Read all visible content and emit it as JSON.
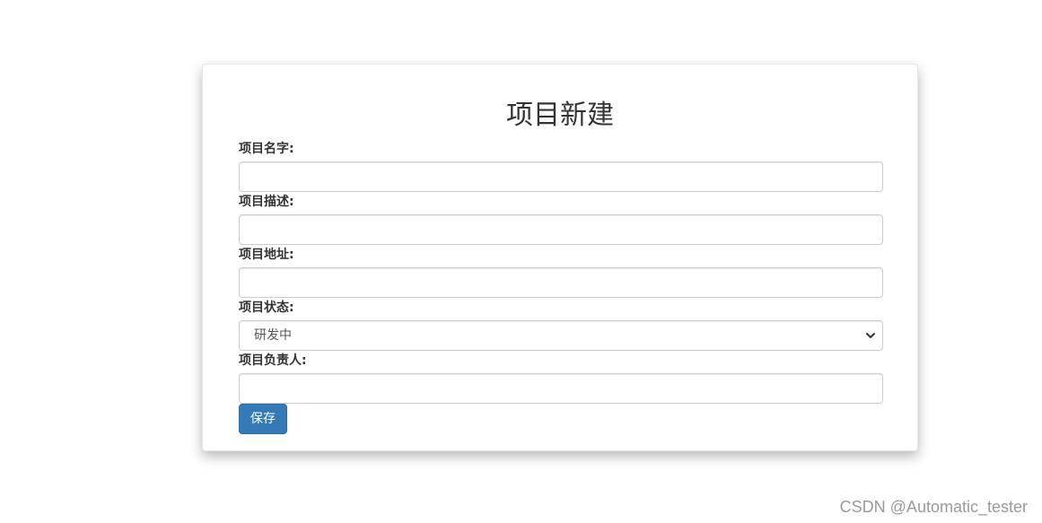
{
  "form": {
    "title": "项目新建",
    "fields": [
      {
        "label": "项目名字:",
        "value": ""
      },
      {
        "label": "项目描述:",
        "value": ""
      },
      {
        "label": "项目地址:",
        "value": ""
      },
      {
        "label": "项目状态:",
        "selected": "研发中"
      },
      {
        "label": "项目负责人:",
        "value": ""
      }
    ],
    "save_label": "保存"
  },
  "watermark": "CSDN @Automatic_tester",
  "colors": {
    "primary_button": "#337ab7",
    "input_border": "#cccccc",
    "text": "#333333"
  },
  "icons": {
    "select_arrow": "chevron-down-icon"
  }
}
